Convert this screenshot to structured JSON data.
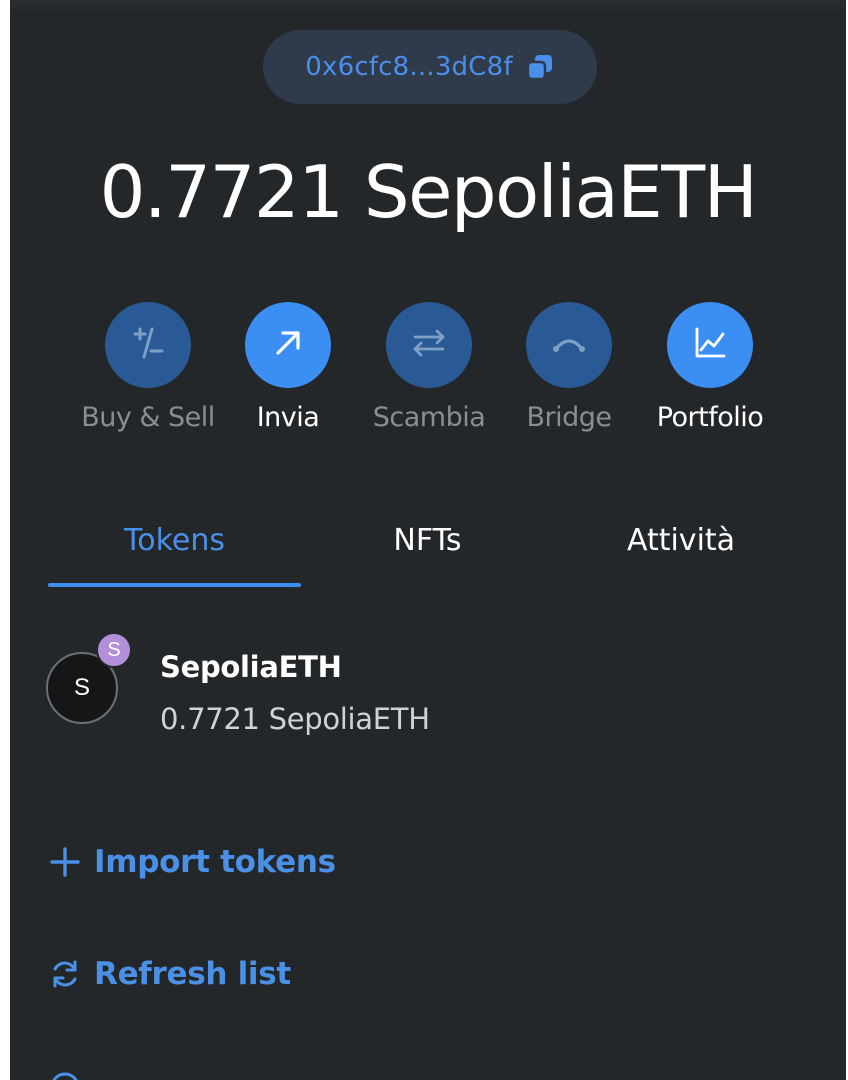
{
  "account": {
    "address_short": "0x6cfc8...3dC8f"
  },
  "balance": {
    "display": "0.7721 SepoliaETH"
  },
  "actions": [
    {
      "label": "Buy & Sell",
      "icon": "plus-minus-icon",
      "enabled": false
    },
    {
      "label": "Invia",
      "icon": "arrow-up-right-icon",
      "enabled": true
    },
    {
      "label": "Scambia",
      "icon": "swap-arrows-icon",
      "enabled": false
    },
    {
      "label": "Bridge",
      "icon": "bridge-icon",
      "enabled": false
    },
    {
      "label": "Portfolio",
      "icon": "chart-icon",
      "enabled": true
    }
  ],
  "tabs": [
    {
      "label": "Tokens",
      "active": true
    },
    {
      "label": "NFTs",
      "active": false
    },
    {
      "label": "Attività",
      "active": false
    }
  ],
  "tokens": [
    {
      "avatar_letter": "S",
      "network_badge_letter": "S",
      "name": "SepoliaETH",
      "amount": "0.7721 SepoliaETH"
    }
  ],
  "links": {
    "import_tokens": "Import tokens",
    "refresh_list": "Refresh list"
  },
  "colors": {
    "background": "#24272a",
    "accent": "#3b8ff3",
    "accent_dim": "#2a5a95",
    "link": "#4a90e6",
    "pill": "#2f3a4b",
    "badge": "#b38fd9"
  }
}
